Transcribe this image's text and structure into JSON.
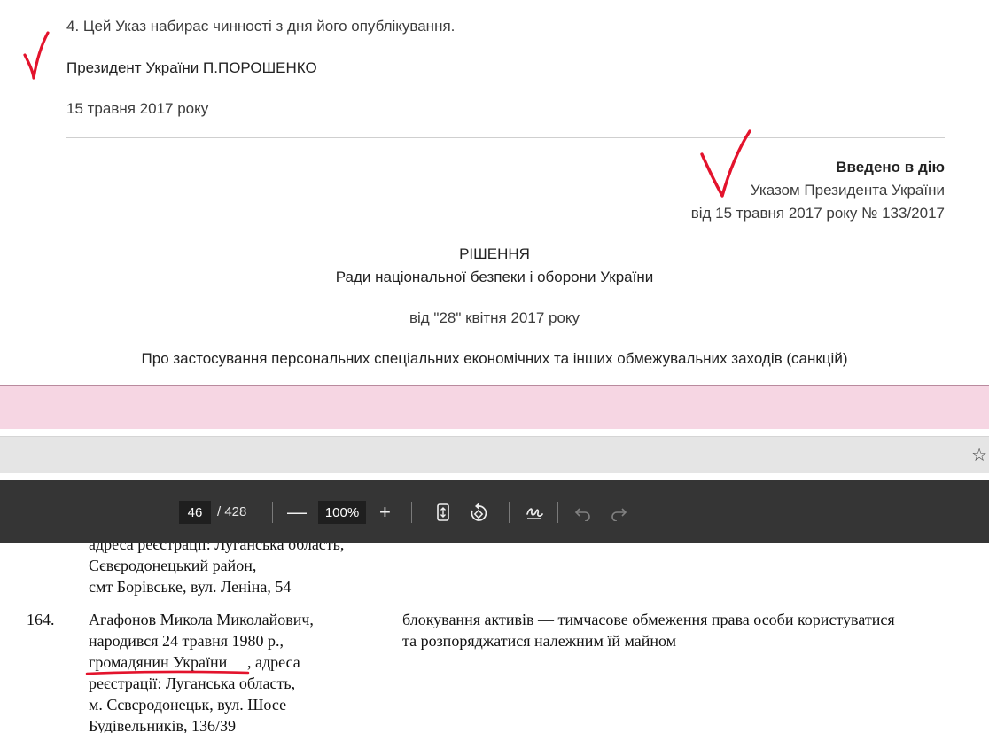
{
  "web_document": {
    "item4": "4. Цей Указ набирає чинності з дня його опублікування.",
    "signer": "Президент України  П.ПОРОШЕНКО",
    "sign_date": "15 травня 2017 року",
    "introduced": "Введено в дію",
    "by_decree": "Указом Президента України",
    "decree_ref": "від 15 травня 2017 року № 133/2017",
    "decision": "РІШЕННЯ",
    "council": "Ради національної безпеки і оборони України",
    "decision_date": "від \"28\" квітня 2017 року",
    "subject": "Про застосування персональних спеціальних економічних та інших обмежувальних заходів (санкцій)"
  },
  "pdf_toolbar": {
    "page_current": "46",
    "page_total": "/ 428",
    "zoom_out": "—",
    "zoom_level": "100%",
    "zoom_in": "+",
    "icons": [
      "fit-page-icon",
      "rotate-icon",
      "annotate-icon",
      "undo-icon",
      "redo-icon"
    ]
  },
  "pdf_page": {
    "prev_entry_lines": [
      "адреса реєстрації: Луганська область,",
      "Сєвєродонецький район,",
      "смт Борівське, вул. Леніна, 54"
    ],
    "entry_number": "164.",
    "entry_person_lines": [
      "Агафонов Микола Миколайович,",
      "народився 24 травня 1980 р.,",
      "громадянин України",
      ", адреса",
      "реєстрації: Луганська область,",
      "м. Сєвєродонецьк, вул. Шосе",
      "Будівельників, 136/39"
    ],
    "sanction_lines": [
      "блокування активів — тимчасове обмеження права особи користуватися",
      "та розпоряджатися належним їй майном"
    ]
  },
  "colors": {
    "annotation_red": "#e3132c",
    "pink_band": "#f6d6e3",
    "toolbar_bg": "#353535"
  }
}
